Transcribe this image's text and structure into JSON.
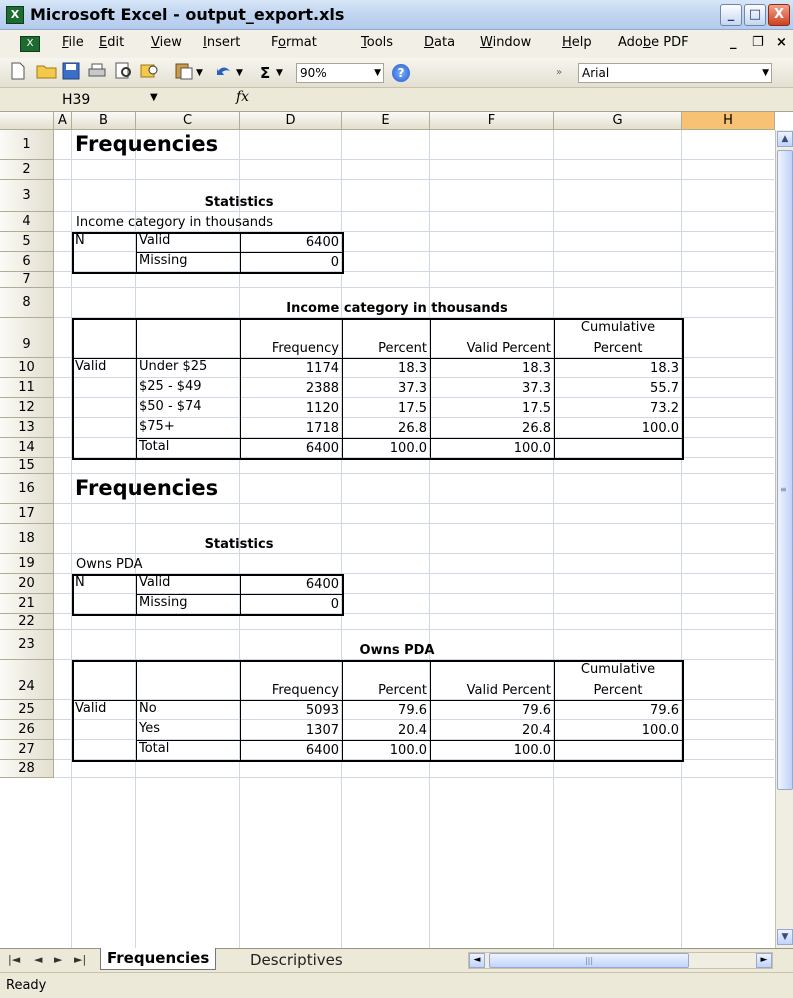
{
  "window": {
    "title": "Microsoft Excel - output_export.xls",
    "app_icon": "X",
    "min": "_",
    "max": "□",
    "close": "X"
  },
  "menu": {
    "items": [
      {
        "pre": "",
        "u": "F",
        "post": "ile"
      },
      {
        "pre": "",
        "u": "E",
        "post": "dit"
      },
      {
        "pre": "",
        "u": "V",
        "post": "iew"
      },
      {
        "pre": "",
        "u": "I",
        "post": "nsert"
      },
      {
        "pre": "F",
        "u": "o",
        "post": "rmat"
      },
      {
        "pre": "",
        "u": "T",
        "post": "ools"
      },
      {
        "pre": "",
        "u": "D",
        "post": "ata"
      },
      {
        "pre": "",
        "u": "W",
        "post": "indow"
      },
      {
        "pre": "",
        "u": "H",
        "post": "elp"
      },
      {
        "pre": "Ado",
        "u": "b",
        "post": "e PDF"
      }
    ],
    "doc_min": "_",
    "doc_restore": "❐",
    "doc_close": "×"
  },
  "toolbar": {
    "sigma": "Σ",
    "zoom": "90%",
    "help": "?",
    "font": "Arial"
  },
  "formula": {
    "namebox": "H39",
    "fx": "fx"
  },
  "columns": [
    "A",
    "B",
    "C",
    "D",
    "E",
    "F",
    "G",
    "H"
  ],
  "rows": [
    "1",
    "2",
    "3",
    "4",
    "5",
    "6",
    "7",
    "8",
    "9",
    "10",
    "11",
    "12",
    "13",
    "14",
    "15",
    "16",
    "17",
    "18",
    "19",
    "20",
    "21",
    "22",
    "23",
    "24",
    "25",
    "26",
    "27",
    "28"
  ],
  "sheet": {
    "s1": {
      "heading": "Frequencies",
      "stats_title": "Statistics",
      "variable": "Income category in thousands",
      "n_label": "N",
      "valid_label": "Valid",
      "missing_label": "Missing",
      "valid_n": "6400",
      "missing_n": "0",
      "table_title": "Income category in thousands",
      "header": {
        "frequency": "Frequency",
        "percent": "Percent",
        "valid_percent": "Valid Percent",
        "cumulative_1": "Cumulative",
        "cumulative_2": "Percent"
      },
      "valid_label_row": "Valid",
      "rows": [
        {
          "label": "Under $25",
          "frequency": "1174",
          "percent": "18.3",
          "valid_percent": "18.3",
          "cumulative": "18.3"
        },
        {
          "label": "$25 - $49",
          "frequency": "2388",
          "percent": "37.3",
          "valid_percent": "37.3",
          "cumulative": "55.7"
        },
        {
          "label": "$50 - $74",
          "frequency": "1120",
          "percent": "17.5",
          "valid_percent": "17.5",
          "cumulative": "73.2"
        },
        {
          "label": "$75+",
          "frequency": "1718",
          "percent": "26.8",
          "valid_percent": "26.8",
          "cumulative": "100.0"
        },
        {
          "label": "Total",
          "frequency": "6400",
          "percent": "100.0",
          "valid_percent": "100.0",
          "cumulative": ""
        }
      ]
    },
    "s2": {
      "heading": "Frequencies",
      "stats_title": "Statistics",
      "variable": "Owns PDA",
      "n_label": "N",
      "valid_label": "Valid",
      "missing_label": "Missing",
      "valid_n": "6400",
      "missing_n": "0",
      "table_title": "Owns PDA",
      "header": {
        "frequency": "Frequency",
        "percent": "Percent",
        "valid_percent": "Valid Percent",
        "cumulative_1": "Cumulative",
        "cumulative_2": "Percent"
      },
      "valid_label_row": "Valid",
      "rows": [
        {
          "label": "No",
          "frequency": "5093",
          "percent": "79.6",
          "valid_percent": "79.6",
          "cumulative": "79.6"
        },
        {
          "label": "Yes",
          "frequency": "1307",
          "percent": "20.4",
          "valid_percent": "20.4",
          "cumulative": "100.0"
        },
        {
          "label": "Total",
          "frequency": "6400",
          "percent": "100.0",
          "valid_percent": "100.0",
          "cumulative": ""
        }
      ]
    }
  },
  "tabs": {
    "first": "|◄",
    "prev": "◄",
    "next": "►",
    "last": "►|",
    "items": [
      "Frequencies",
      "Descriptives"
    ]
  },
  "status": {
    "text": "Ready"
  }
}
